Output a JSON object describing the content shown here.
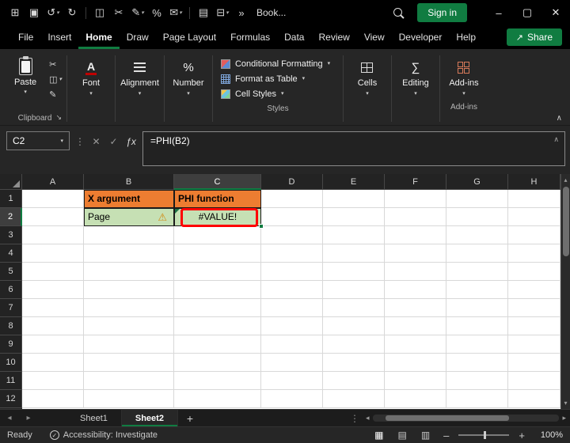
{
  "colors": {
    "accent": "#107C41",
    "header_orange": "#ED7D31",
    "cell_green": "#C6E0B4",
    "annotation_red": "#FF0000"
  },
  "titlebar": {
    "icons": [
      {
        "name": "excel-app-icon",
        "glyph": "⊞"
      },
      {
        "name": "save-icon",
        "glyph": "▣"
      },
      {
        "name": "undo-icon",
        "glyph": "↺",
        "dropdown": true
      },
      {
        "name": "redo-icon",
        "glyph": "↻"
      },
      {
        "name": "divider",
        "glyph": ""
      },
      {
        "name": "copy-icon",
        "glyph": "◫"
      },
      {
        "name": "cut-icon",
        "glyph": "✂"
      },
      {
        "name": "format-painter-icon",
        "glyph": "✎",
        "dropdown": true
      },
      {
        "name": "number-format-icon",
        "glyph": "%"
      },
      {
        "name": "comment-icon",
        "glyph": "✉",
        "dropdown": true
      },
      {
        "name": "divider",
        "glyph": ""
      },
      {
        "name": "print-icon",
        "glyph": "▤"
      },
      {
        "name": "table-icon",
        "glyph": "⊟",
        "dropdown": true
      },
      {
        "name": "more-commands-icon",
        "glyph": "»"
      }
    ],
    "workbook_name": "Book...",
    "sign_in": "Sign in",
    "window_controls": [
      {
        "name": "minimize-button",
        "glyph": "–"
      },
      {
        "name": "maximize-button",
        "glyph": "▢"
      },
      {
        "name": "close-button",
        "glyph": "✕"
      }
    ]
  },
  "menubar": {
    "tabs": [
      "File",
      "Insert",
      "Home",
      "Draw",
      "Page Layout",
      "Formulas",
      "Data",
      "Review",
      "View",
      "Developer",
      "Help"
    ],
    "active": "Home",
    "share": "Share",
    "share_icon": "↗"
  },
  "ribbon": {
    "paste": "Paste",
    "mini": [
      {
        "name": "cut-button",
        "glyph": "✂"
      },
      {
        "name": "copy-button",
        "glyph": "◫",
        "dropdown": true
      },
      {
        "name": "format-painter-button",
        "glyph": "✎"
      }
    ],
    "groups": {
      "clipboard": "Clipboard",
      "font": "Font",
      "alignment": "Alignment",
      "number": "Number",
      "styles": "Styles",
      "cells": "Cells",
      "editing": "Editing",
      "addins": "Add-ins"
    },
    "icons": {
      "font": "A",
      "number": "%",
      "editing": "∑",
      "dialog_launcher": "↘",
      "collapse": "∧"
    },
    "styles_items": [
      "Conditional Formatting",
      "Format as Table",
      "Cell Styles"
    ],
    "addins_button": "Add-ins"
  },
  "formula_bar": {
    "name_box": "C2",
    "cancel": "✕",
    "enter": "✓",
    "fx": "ƒx",
    "formula": "=PHI(B2)",
    "collapse": "∧"
  },
  "grid": {
    "columns": [
      "A",
      "B",
      "C",
      "D",
      "E",
      "F",
      "G",
      "H"
    ],
    "rows": [
      "1",
      "2",
      "3",
      "4",
      "5",
      "6",
      "7",
      "8",
      "9",
      "10",
      "11",
      "12"
    ],
    "selected_column": "C",
    "selected_row": "2",
    "active_cell": "C2",
    "cells": {
      "B1": "X argument",
      "C1": "PHI function",
      "B2": "Page",
      "C2": "#VALUE!"
    },
    "cell_fills": {
      "B1": "#ED7D31",
      "C1": "#ED7D31",
      "B2": "#C6E0B4",
      "C2": "#C6E0B4"
    },
    "bold_cells": [
      "B1",
      "C1"
    ],
    "centered_cells": [
      "C2"
    ],
    "bordered_cells": [
      "B1",
      "C1",
      "B2",
      "C2"
    ],
    "warning_cell": "B2",
    "warning_icon": "⚠",
    "error_cell": "C2"
  },
  "sheet_tabs": {
    "tabs": [
      "Sheet1",
      "Sheet2"
    ],
    "active": "Sheet2",
    "add_label": "+"
  },
  "status_bar": {
    "ready": "Ready",
    "accessibility_icon": "✓",
    "accessibility": "Accessibility: Investigate",
    "view_icons": [
      {
        "name": "normal-view-button",
        "glyph": "▦"
      },
      {
        "name": "page-layout-view-button",
        "glyph": "▤"
      },
      {
        "name": "page-break-preview-button",
        "glyph": "▥"
      }
    ],
    "zoom_out": "–",
    "zoom_in": "+",
    "zoom": "100%"
  }
}
